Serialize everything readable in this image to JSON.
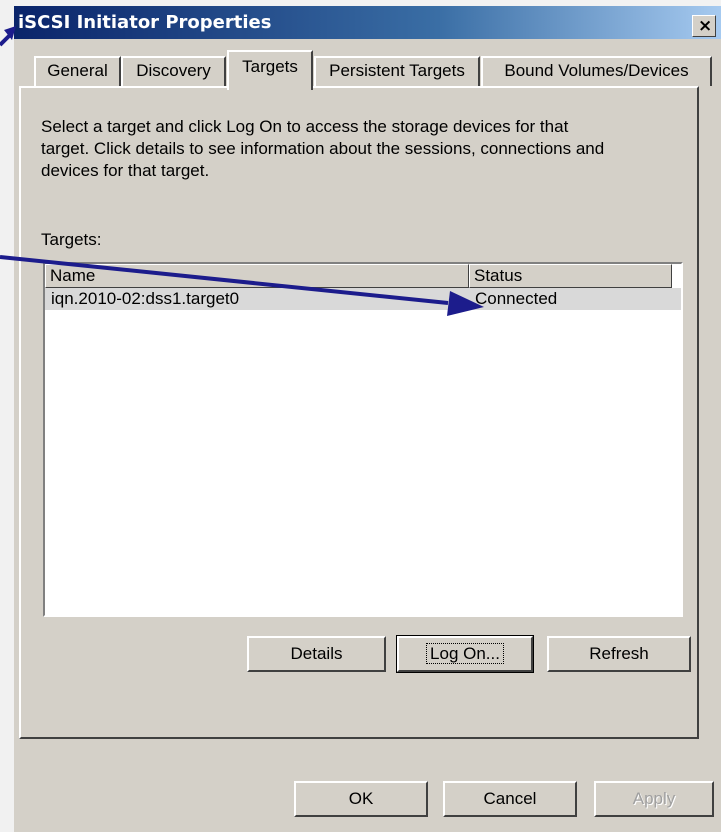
{
  "window": {
    "title": "iSCSI Initiator Properties",
    "close_glyph": "×"
  },
  "tabs": [
    {
      "label": "General"
    },
    {
      "label": "Discovery"
    },
    {
      "label": "Targets"
    },
    {
      "label": "Persistent Targets"
    },
    {
      "label": "Bound Volumes/Devices"
    }
  ],
  "active_tab": "Targets",
  "targets_page": {
    "description": "Select a target and click Log On to access the storage devices for that\ntarget. Click details to see information about the sessions, connections and\ndevices for that target.",
    "list_label": "Targets:",
    "columns": [
      "Name",
      "Status"
    ],
    "rows": [
      {
        "name": "iqn.2010-02:dss1.target0",
        "status": "Connected"
      }
    ],
    "buttons": {
      "details": "Details",
      "log_on": "Log On...",
      "refresh": "Refresh"
    }
  },
  "footer": {
    "ok": "OK",
    "cancel": "Cancel",
    "apply": "Apply"
  },
  "colors": {
    "arrow": "#1c1c8c",
    "titlebar": "#0a246a",
    "face": "#d4d0c8"
  }
}
